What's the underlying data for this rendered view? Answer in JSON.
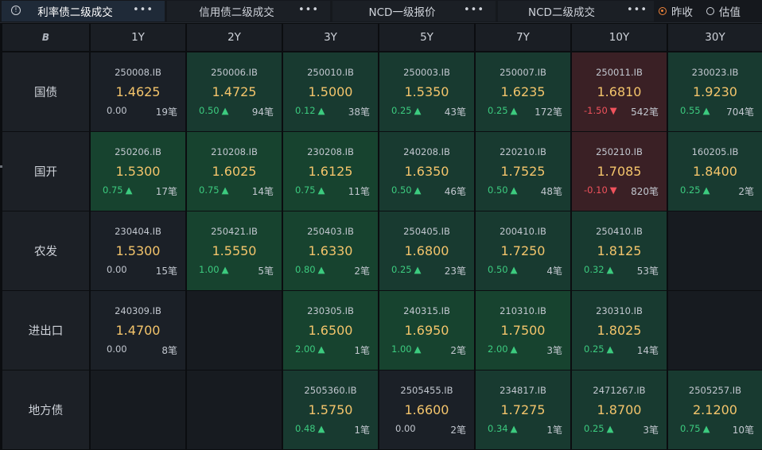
{
  "tabs": [
    {
      "label": "利率债二级成交",
      "active": true
    },
    {
      "label": "信用债二级成交",
      "active": false
    },
    {
      "label": "NCD一级报价",
      "active": false
    },
    {
      "label": "NCD二级成交",
      "active": false
    }
  ],
  "more_glyph": "•••",
  "info_glyph": "!",
  "radio_options": [
    {
      "label": "昨收",
      "checked": true
    },
    {
      "label": "估值",
      "checked": false
    }
  ],
  "corner_logo": "B",
  "columns": [
    "1Y",
    "2Y",
    "3Y",
    "5Y",
    "7Y",
    "10Y",
    "30Y"
  ],
  "rows": [
    {
      "label": "国债",
      "cells": [
        {
          "code": "250008.IB",
          "price": "1.4625",
          "change": "0.00",
          "dir": "flat",
          "count": "19笔",
          "tone": "neutral"
        },
        {
          "code": "250006.IB",
          "price": "1.4725",
          "change": "0.50",
          "dir": "up",
          "count": "94笔",
          "tone": "up"
        },
        {
          "code": "250010.IB",
          "price": "1.5000",
          "change": "0.12",
          "dir": "up",
          "count": "38笔",
          "tone": "up"
        },
        {
          "code": "250003.IB",
          "price": "1.5350",
          "change": "0.25",
          "dir": "up",
          "count": "43笔",
          "tone": "up"
        },
        {
          "code": "250007.IB",
          "price": "1.6235",
          "change": "0.25",
          "dir": "up",
          "count": "172笔",
          "tone": "up"
        },
        {
          "code": "250011.IB",
          "price": "1.6810",
          "change": "-1.50",
          "dir": "down",
          "count": "542笔",
          "tone": "down"
        },
        {
          "code": "230023.IB",
          "price": "1.9230",
          "change": "0.55",
          "dir": "up",
          "count": "704笔",
          "tone": "up"
        }
      ]
    },
    {
      "label": "国开",
      "cells": [
        {
          "code": "250206.IB",
          "price": "1.5300",
          "change": "0.75",
          "dir": "up",
          "count": "17笔",
          "tone": "upstrong"
        },
        {
          "code": "210208.IB",
          "price": "1.6025",
          "change": "0.75",
          "dir": "up",
          "count": "14笔",
          "tone": "upstrong"
        },
        {
          "code": "230208.IB",
          "price": "1.6125",
          "change": "0.75",
          "dir": "up",
          "count": "11笔",
          "tone": "upstrong"
        },
        {
          "code": "240208.IB",
          "price": "1.6350",
          "change": "0.50",
          "dir": "up",
          "count": "46笔",
          "tone": "up"
        },
        {
          "code": "220210.IB",
          "price": "1.7525",
          "change": "0.50",
          "dir": "up",
          "count": "48笔",
          "tone": "up"
        },
        {
          "code": "250210.IB",
          "price": "1.7085",
          "change": "-0.10",
          "dir": "down",
          "count": "820笔",
          "tone": "down"
        },
        {
          "code": "160205.IB",
          "price": "1.8400",
          "change": "0.25",
          "dir": "up",
          "count": "2笔",
          "tone": "up"
        }
      ]
    },
    {
      "label": "农发",
      "cells": [
        {
          "code": "230404.IB",
          "price": "1.5300",
          "change": "0.00",
          "dir": "flat",
          "count": "15笔",
          "tone": "neutral"
        },
        {
          "code": "250421.IB",
          "price": "1.5550",
          "change": "1.00",
          "dir": "up",
          "count": "5笔",
          "tone": "upstrong"
        },
        {
          "code": "250403.IB",
          "price": "1.6330",
          "change": "0.80",
          "dir": "up",
          "count": "2笔",
          "tone": "upstrong"
        },
        {
          "code": "250405.IB",
          "price": "1.6800",
          "change": "0.25",
          "dir": "up",
          "count": "23笔",
          "tone": "up"
        },
        {
          "code": "200410.IB",
          "price": "1.7250",
          "change": "0.50",
          "dir": "up",
          "count": "4笔",
          "tone": "up"
        },
        {
          "code": "250410.IB",
          "price": "1.8125",
          "change": "0.32",
          "dir": "up",
          "count": "53笔",
          "tone": "up"
        },
        null
      ]
    },
    {
      "label": "进出口",
      "cells": [
        {
          "code": "240309.IB",
          "price": "1.4700",
          "change": "0.00",
          "dir": "flat",
          "count": "8笔",
          "tone": "neutral"
        },
        null,
        {
          "code": "230305.IB",
          "price": "1.6500",
          "change": "2.00",
          "dir": "up",
          "count": "1笔",
          "tone": "upstrong"
        },
        {
          "code": "240315.IB",
          "price": "1.6950",
          "change": "1.00",
          "dir": "up",
          "count": "2笔",
          "tone": "upstrong"
        },
        {
          "code": "210310.IB",
          "price": "1.7500",
          "change": "2.00",
          "dir": "up",
          "count": "3笔",
          "tone": "upstrong"
        },
        {
          "code": "230310.IB",
          "price": "1.8025",
          "change": "0.25",
          "dir": "up",
          "count": "14笔",
          "tone": "up"
        },
        null
      ]
    },
    {
      "label": "地方债",
      "cells": [
        null,
        null,
        {
          "code": "2505360.IB",
          "price": "1.5750",
          "change": "0.48",
          "dir": "up",
          "count": "1笔",
          "tone": "up"
        },
        {
          "code": "2505455.IB",
          "price": "1.6600",
          "change": "0.00",
          "dir": "flat",
          "count": "2笔",
          "tone": "neutral"
        },
        {
          "code": "234817.IB",
          "price": "1.7275",
          "change": "0.34",
          "dir": "up",
          "count": "1笔",
          "tone": "up"
        },
        {
          "code": "2471267.IB",
          "price": "1.8700",
          "change": "0.25",
          "dir": "up",
          "count": "3笔",
          "tone": "up"
        },
        {
          "code": "2505257.IB",
          "price": "2.1200",
          "change": "0.75",
          "dir": "up",
          "count": "10笔",
          "tone": "up"
        }
      ]
    }
  ],
  "arrows": {
    "up": "▲",
    "down": "▼"
  }
}
